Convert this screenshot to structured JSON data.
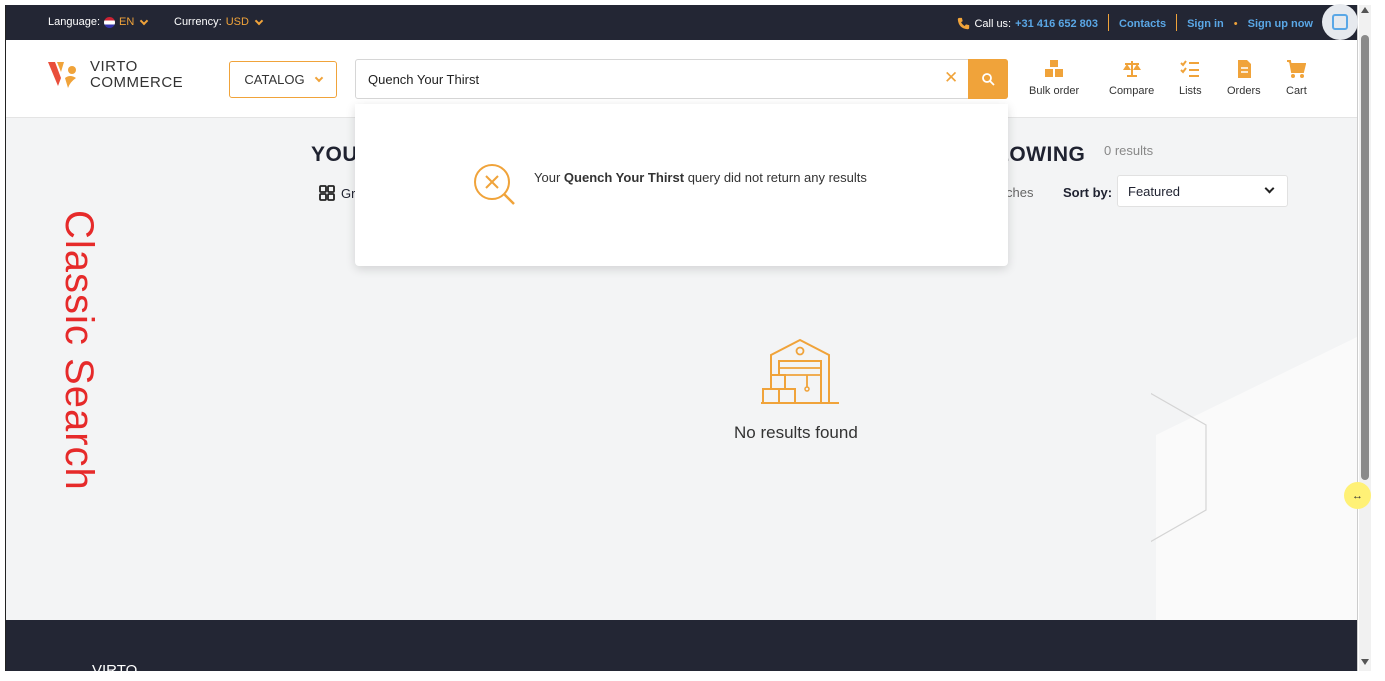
{
  "topbar": {
    "language_label": "Language:",
    "language_value": "EN",
    "currency_label": "Currency:",
    "currency_value": "USD",
    "call_label": "Call us:",
    "phone": "+31 416 652 803",
    "contacts": "Contacts",
    "sign_in": "Sign in",
    "dot": "•",
    "sign_up": "Sign up now"
  },
  "header": {
    "logo_line1": "VIRTO",
    "logo_line2": "COMMERCE",
    "catalog_label": "CATALOG",
    "search_value": "Quench Your Thirst",
    "nav": [
      {
        "label": "Bulk order",
        "icon": "boxes-icon"
      },
      {
        "label": "Compare",
        "icon": "scales-icon"
      },
      {
        "label": "Lists",
        "icon": "checklist-icon"
      },
      {
        "label": "Orders",
        "icon": "document-icon"
      },
      {
        "label": "Cart",
        "icon": "cart-icon"
      }
    ]
  },
  "main": {
    "side_label": "Classic Search",
    "heading_left": "YOU",
    "heading_right": "LOWING",
    "results_count": "0 results",
    "grid_label": "Gr",
    "searches_text": "ches",
    "sort_label": "Sort by:",
    "sort_value": "Featured",
    "empty_title": "No results found"
  },
  "dropdown": {
    "prefix": "Your",
    "query": "Quench Your Thirst",
    "suffix": "query did not return any results"
  },
  "footer": {
    "logo_text": "VIRTO"
  },
  "colors": {
    "accent": "#f0a33a",
    "topbar": "#232634",
    "link": "#5aa7e6",
    "side_label": "#e62a2a"
  }
}
